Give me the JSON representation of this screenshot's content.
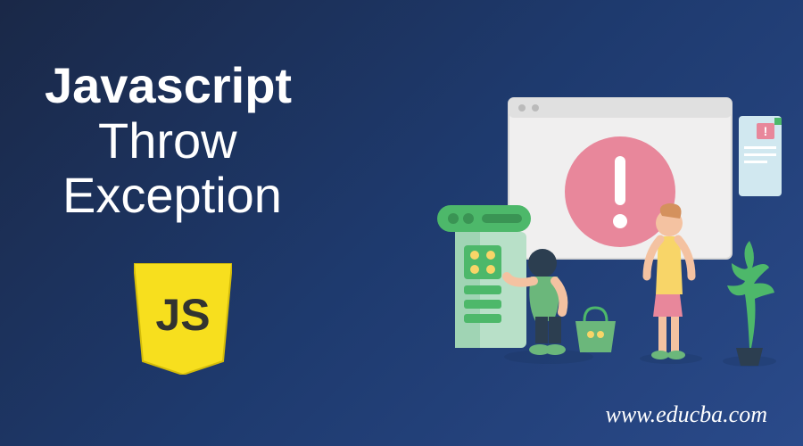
{
  "title": {
    "line1": "Javascript",
    "line2": "Throw",
    "line3": "Exception"
  },
  "logo": {
    "text": "JS",
    "bg_color": "#F7DF1E",
    "text_color": "#323330"
  },
  "website": "www.educba.com",
  "illustration": {
    "warning_color": "#E8879B",
    "warning_symbol": "!",
    "accent_green": "#4DB86A",
    "accent_blue": "#7FC4D9"
  }
}
